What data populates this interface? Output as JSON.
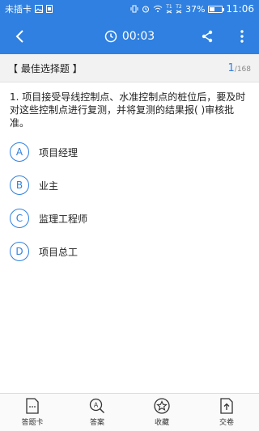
{
  "status_bar": {
    "carrier": "未插卡",
    "signal_1": "T1",
    "signal_2": "T2",
    "battery_percent": "37%",
    "battery_level": 0.37,
    "time": "11:06"
  },
  "app_bar": {
    "timer": "00:03",
    "icons": [
      "back-arrow-icon",
      "clock-icon",
      "share-icon",
      "more-vert-icon"
    ]
  },
  "question_header": {
    "type_label": "【 最佳选择题 】",
    "current": "1",
    "total": "/168"
  },
  "question": {
    "text": "1. 项目接受导线控制点、水准控制点的桩位后，要及时对这些控制点进行复测，并将复测的结果报(   )审核批准。"
  },
  "options": [
    {
      "letter": "A",
      "text": "项目经理"
    },
    {
      "letter": "B",
      "text": "业主"
    },
    {
      "letter": "C",
      "text": "监理工程师"
    },
    {
      "letter": "D",
      "text": "项目总工"
    }
  ],
  "bottom_tabs": [
    {
      "label": "答题卡",
      "icon": "answer-card-icon"
    },
    {
      "label": "答案",
      "icon": "answer-search-icon"
    },
    {
      "label": "收藏",
      "icon": "star-icon"
    },
    {
      "label": "交卷",
      "icon": "submit-icon"
    }
  ],
  "colors": {
    "primary": "#2f80e0",
    "header_bg": "#f2f2f2"
  }
}
